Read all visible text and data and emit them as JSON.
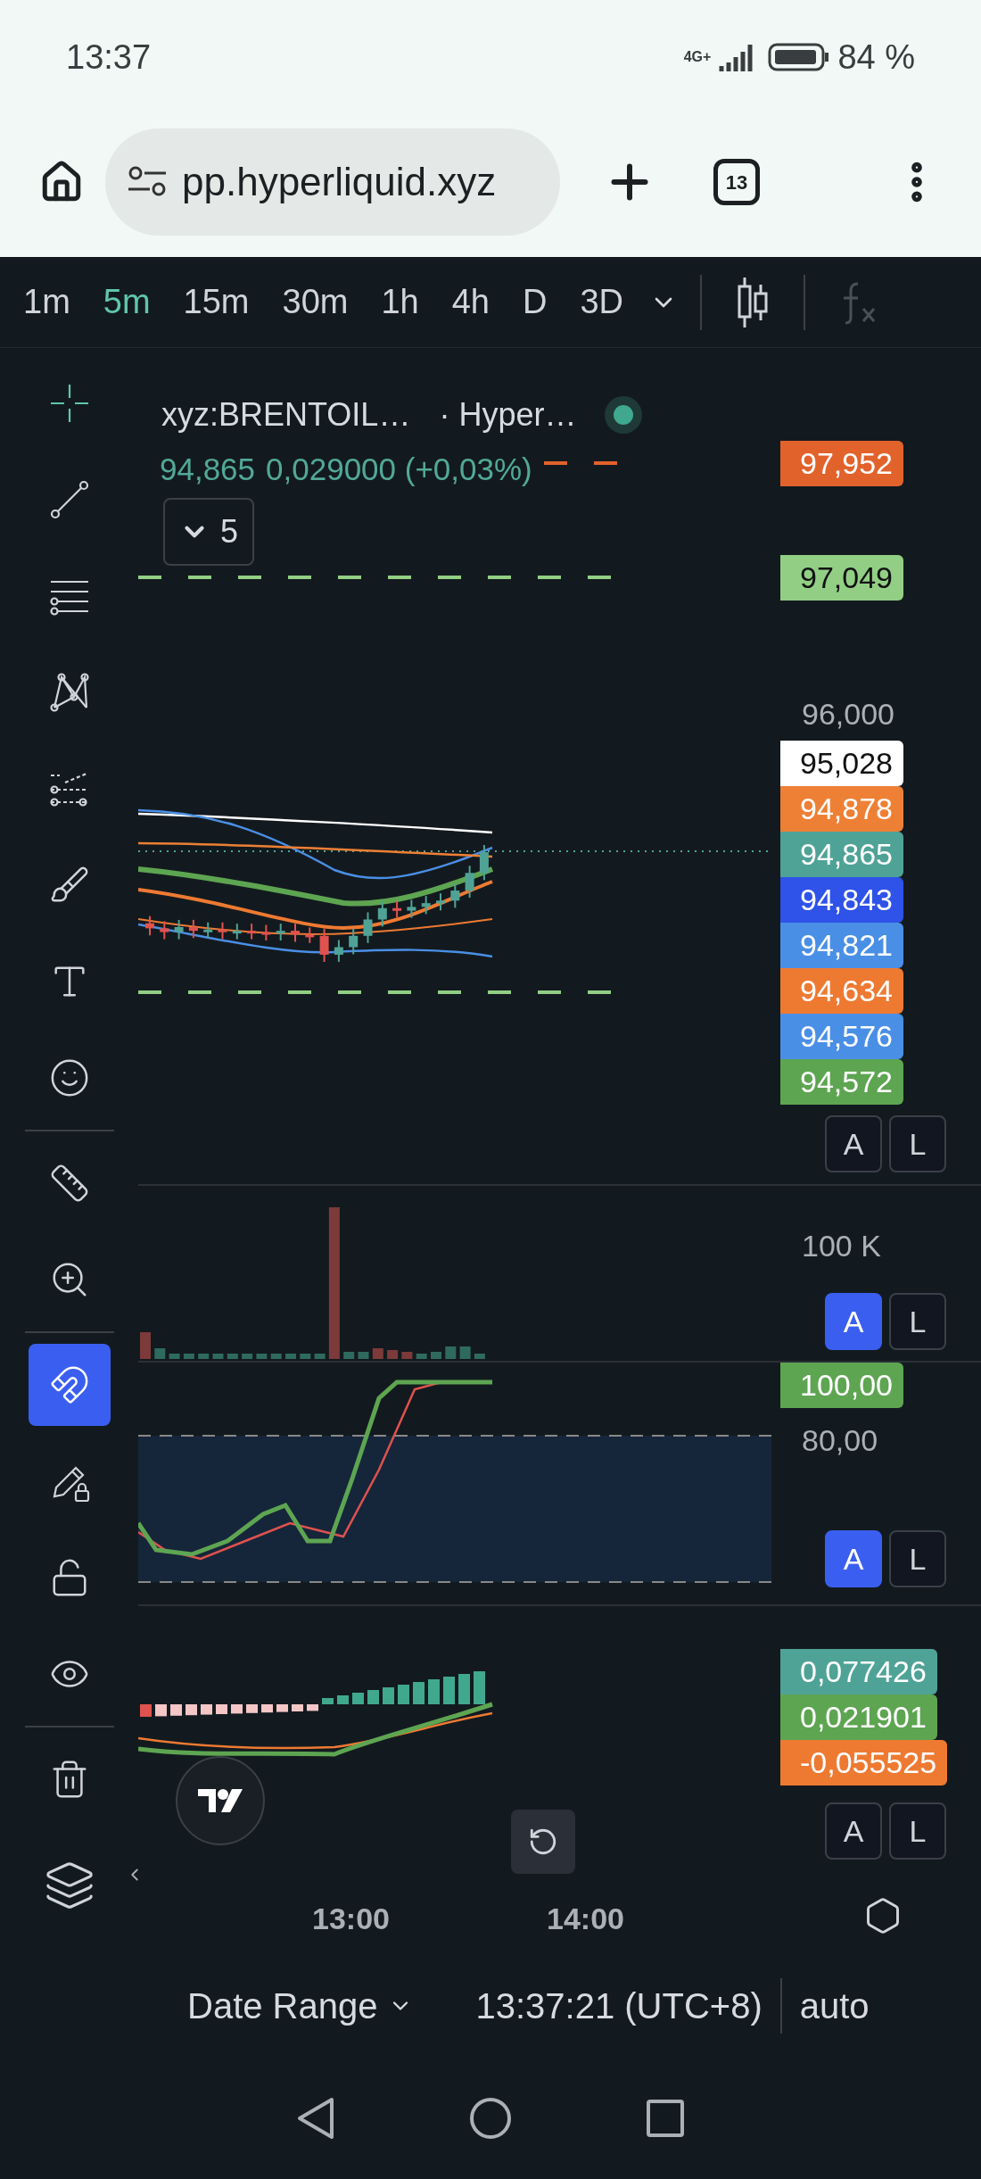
{
  "status_bar": {
    "time": "13:37",
    "network": "4G+",
    "battery": "84 %"
  },
  "browser": {
    "url": "pp.hyperliquid.xyz",
    "tab_count": "13"
  },
  "timeframes": [
    {
      "label": "1m",
      "selected": false
    },
    {
      "label": "5m",
      "selected": true
    },
    {
      "label": "15m",
      "selected": false
    },
    {
      "label": "30m",
      "selected": false
    },
    {
      "label": "1h",
      "selected": false
    },
    {
      "label": "4h",
      "selected": false
    },
    {
      "label": "D",
      "selected": false
    },
    {
      "label": "3D",
      "selected": false
    }
  ],
  "tools": [
    {
      "kind": "crosshair",
      "active": true
    },
    {
      "kind": "trendline",
      "active": false
    },
    {
      "kind": "fib",
      "active": false
    },
    {
      "kind": "pattern",
      "active": false
    },
    {
      "kind": "forecast",
      "active": false
    },
    {
      "kind": "brush",
      "active": false
    },
    {
      "kind": "text",
      "active": false
    },
    {
      "kind": "emoji",
      "active": false
    },
    {
      "kind": "ruler",
      "active": false
    },
    {
      "kind": "zoom",
      "active": false
    },
    {
      "kind": "magnet",
      "active": true
    },
    {
      "kind": "lock-drawing",
      "active": false
    },
    {
      "kind": "lock",
      "active": false
    },
    {
      "kind": "eye",
      "active": false
    },
    {
      "kind": "trash",
      "active": false
    }
  ],
  "legend": {
    "symbol": "xyz:BRENTOIL…",
    "exchange": "· Hyper…",
    "price": "94,865",
    "change": "0,029000 (+0,03%)",
    "indicator_count": "5"
  },
  "main_pane": {
    "tick": "96,000",
    "line_labels": [
      {
        "value": "97,952",
        "color": "#e2622b"
      },
      {
        "value": "97,049",
        "color": "#92cf85"
      }
    ],
    "stacked_labels": [
      {
        "value": "95,028",
        "color": "#ffffff"
      },
      {
        "value": "94,878",
        "color": "#ee8035"
      },
      {
        "value": "94,865",
        "color": "#4fa396"
      },
      {
        "value": "94,843",
        "color": "#2f52e8"
      },
      {
        "value": "94,821",
        "color": "#4a8fe6"
      },
      {
        "value": "94,634",
        "color": "#ee7a32"
      },
      {
        "value": "94,576",
        "color": "#4a8fe6"
      },
      {
        "value": "94,572",
        "color": "#5ea552"
      }
    ],
    "scale_buttons": [
      {
        "label": "A",
        "selected": false
      },
      {
        "label": "L",
        "selected": false
      }
    ]
  },
  "volume_pane": {
    "tick": "100 K",
    "scale_buttons": [
      {
        "label": "A",
        "selected": true
      },
      {
        "label": "L",
        "selected": false
      }
    ]
  },
  "stoch_pane": {
    "labels": [
      {
        "value": "100,00",
        "color": "#5ea552"
      }
    ],
    "tick": "80,00",
    "scale_buttons": [
      {
        "label": "A",
        "selected": true
      },
      {
        "label": "L",
        "selected": false
      }
    ]
  },
  "macd_pane": {
    "labels": [
      {
        "value": "0,077426",
        "color": "#4fa396"
      },
      {
        "value": "0,021901",
        "color": "#5ea552"
      },
      {
        "value": "-0,055525",
        "color": "#ee7a32"
      }
    ],
    "scale_buttons": [
      {
        "label": "A",
        "selected": false
      },
      {
        "label": "L",
        "selected": false
      }
    ]
  },
  "time_axis": [
    "13:00",
    "14:00"
  ],
  "footer": {
    "date_range": "Date Range",
    "clock": "13:37:21 (UTC+8)",
    "scale_mode": "auto"
  }
}
